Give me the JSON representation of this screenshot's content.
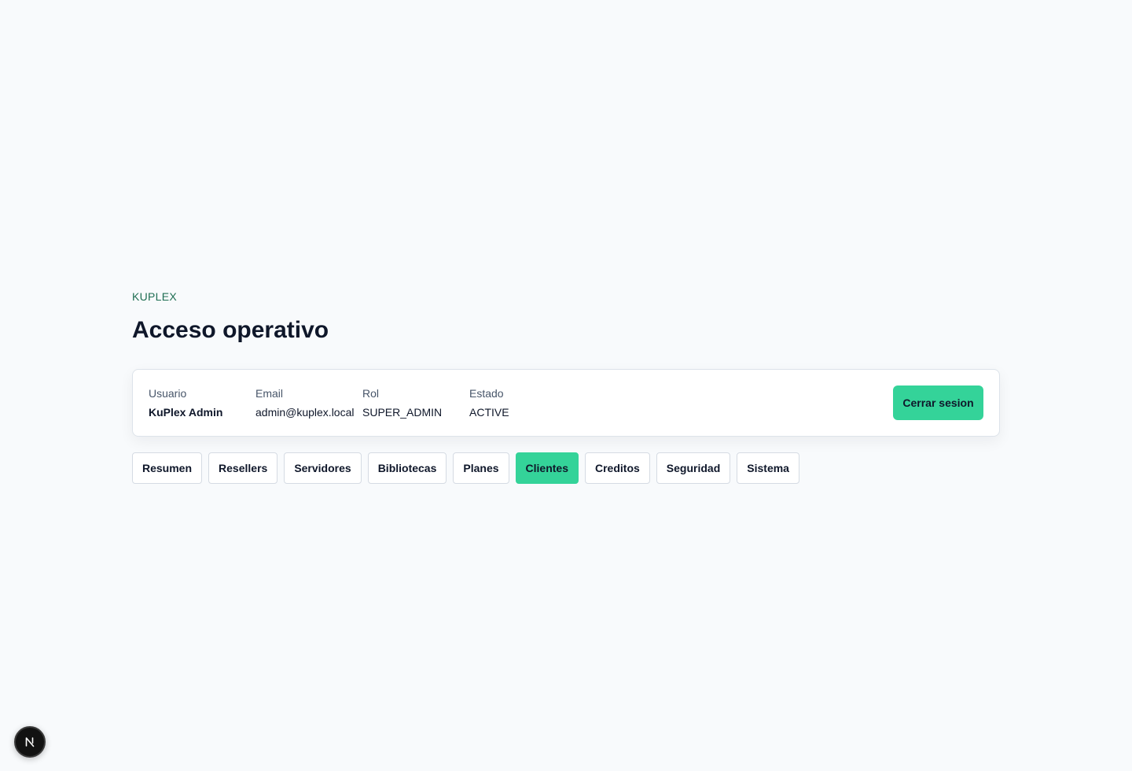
{
  "header": {
    "eyebrow": "KUPLEX",
    "title": "Acceso operativo"
  },
  "user_card": {
    "fields": [
      {
        "label": "Usuario",
        "value": "KuPlex Admin"
      },
      {
        "label": "Email",
        "value": "admin@kuplex.local"
      },
      {
        "label": "Rol",
        "value": "SUPER_ADMIN"
      },
      {
        "label": "Estado",
        "value": "ACTIVE"
      }
    ],
    "logout_label": "Cerrar sesion"
  },
  "tabs": [
    {
      "label": "Resumen",
      "active": false
    },
    {
      "label": "Resellers",
      "active": false
    },
    {
      "label": "Servidores",
      "active": false
    },
    {
      "label": "Bibliotecas",
      "active": false
    },
    {
      "label": "Planes",
      "active": false
    },
    {
      "label": "Clientes",
      "active": true
    },
    {
      "label": "Creditos",
      "active": false
    },
    {
      "label": "Seguridad",
      "active": false
    },
    {
      "label": "Sistema",
      "active": false
    }
  ],
  "colors": {
    "accent": "#34d399",
    "eyebrow": "#1f6e53",
    "background": "#f8fafc"
  },
  "dev_badge": {
    "icon": "nextjs-n-icon"
  }
}
